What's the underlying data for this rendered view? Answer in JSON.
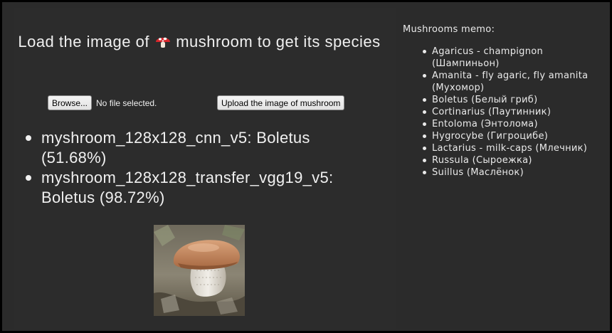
{
  "header": {
    "title_part1": "Load the image of",
    "title_emoji": "mushroom-emoji-icon",
    "title_part2": "mushroom to get its species"
  },
  "upload_form": {
    "browse_label": "Browse...",
    "file_status": "No file selected.",
    "upload_label": "Upload the image of mushroom"
  },
  "results": [
    {
      "model": "myshroom_128x128_cnn_v5",
      "species": "Boletus",
      "confidence": "(51.68%)"
    },
    {
      "model": "myshroom_128x128_transfer_vgg19_v5",
      "species": "Boletus",
      "confidence": "(98.72%)"
    }
  ],
  "memo": {
    "title": "Mushrooms memo:",
    "items": [
      "Agaricus - champignon (Шампиньон)",
      "Amanita - fly agaric, fly amanita (Мухомор)",
      "Boletus (Белый гриб)",
      "Cortinarius (Паутинник)",
      "Entoloma (Энтолома)",
      "Hygrocybe (Гигроцибе)",
      "Lactarius - milk-caps (Млечник)",
      "Russula (Сыроежка)",
      "Suillus (Маслёнок)"
    ]
  },
  "colors": {
    "background": "#2b2b2b",
    "text": "#f0f0f0"
  }
}
